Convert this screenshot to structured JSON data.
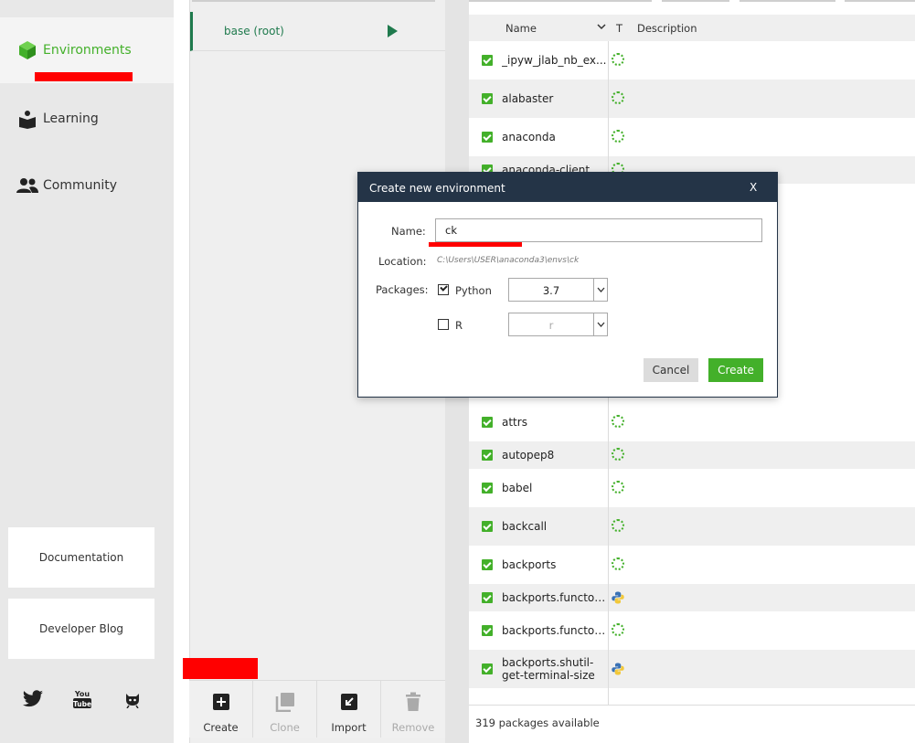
{
  "sidebar": {
    "items": [
      {
        "label": "Environments",
        "icon": "cube-icon"
      },
      {
        "label": "Learning",
        "icon": "book-icon"
      },
      {
        "label": "Community",
        "icon": "people-icon"
      }
    ],
    "documentation": "Documentation",
    "developer_blog": "Developer Blog",
    "social": [
      "twitter-icon",
      "youtube-icon",
      "github-icon"
    ],
    "youtube_text": "You Tube"
  },
  "environments": {
    "items": [
      {
        "label": "base (root)"
      }
    ],
    "actions": [
      {
        "label": "Create",
        "enabled": true
      },
      {
        "label": "Clone",
        "enabled": false
      },
      {
        "label": "Import",
        "enabled": true
      },
      {
        "label": "Remove",
        "enabled": false
      }
    ]
  },
  "packages": {
    "columns": {
      "name": "Name",
      "type": "T",
      "description": "Description"
    },
    "rows": [
      {
        "name": "_ipyw_jlab_nb_ex...",
        "type": "conda"
      },
      {
        "name": "alabaster",
        "type": "conda"
      },
      {
        "name": "anaconda",
        "type": "conda"
      },
      {
        "name": "anaconda-client",
        "type": "conda"
      },
      {
        "name": "attrs",
        "type": "conda"
      },
      {
        "name": "autopep8",
        "type": "conda"
      },
      {
        "name": "babel",
        "type": "conda"
      },
      {
        "name": "backcall",
        "type": "conda"
      },
      {
        "name": "backports",
        "type": "conda"
      },
      {
        "name": "backports.functoo...",
        "type": "python"
      },
      {
        "name": "backports.functoo...",
        "type": "conda"
      },
      {
        "name": "backports.shutil-get-terminal-size",
        "type": "python"
      }
    ],
    "footer": "319 packages available"
  },
  "modal": {
    "title": "Create new environment",
    "close": "X",
    "name_label": "Name:",
    "name_value": "ck",
    "location_label": "Location:",
    "location_value": "C:\\Users\\USER\\anaconda3\\envs\\ck",
    "packages_label": "Packages:",
    "python_label": "Python",
    "python_checked": true,
    "python_version": "3.7",
    "r_label": "R",
    "r_checked": false,
    "r_version": "r",
    "cancel": "Cancel",
    "create": "Create"
  },
  "colors": {
    "accent": "#43b02a",
    "env_active": "#1f7a4d",
    "modal_header": "#243447",
    "annotation_red": "#ff0000"
  }
}
